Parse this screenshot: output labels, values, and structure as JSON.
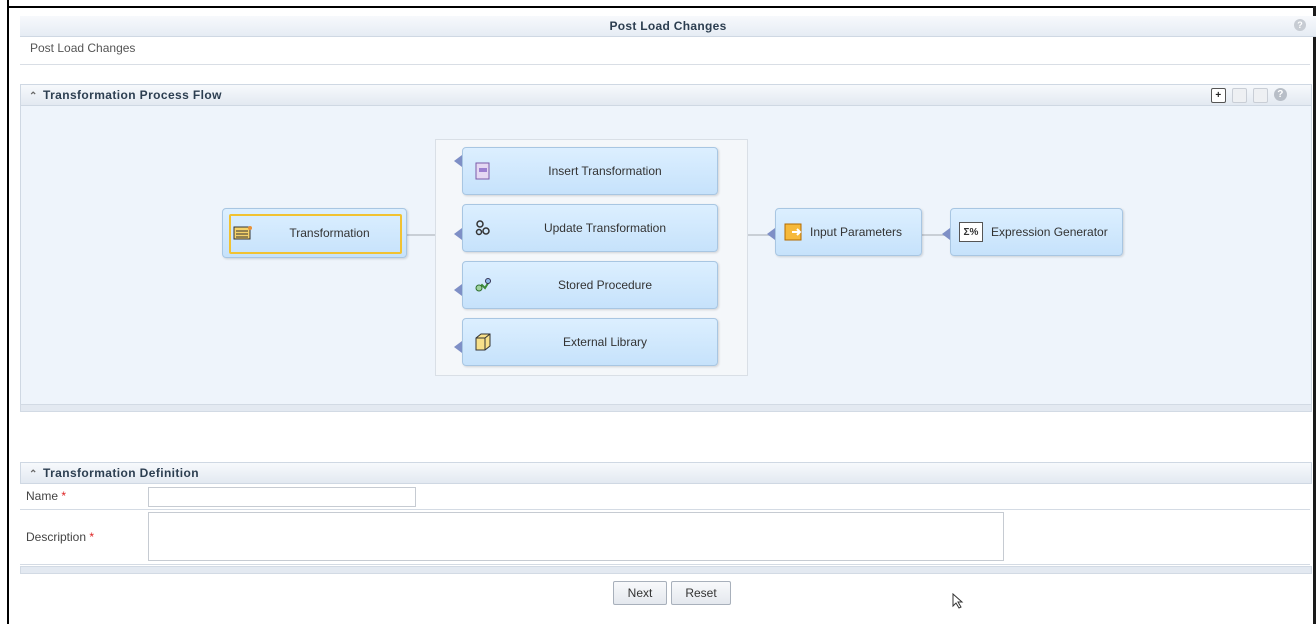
{
  "header": {
    "title": "Post Load Changes",
    "subtitle": "Post Load Changes"
  },
  "flow_section": {
    "title": "Transformation Process Flow",
    "toolbar": [
      "add-icon",
      "edit-icon",
      "list-icon",
      "help-icon"
    ],
    "nodes": {
      "transformation": "Transformation",
      "insert": "Insert Transformation",
      "update": "Update Transformation",
      "stored": "Stored Procedure",
      "external": "External Library",
      "input_params": "Input Parameters",
      "expression": "Expression Generator",
      "expression_icon_text": "Σ%"
    }
  },
  "definition_section": {
    "title": "Transformation Definition",
    "name_label": "Name",
    "name_value": "",
    "description_label": "Description",
    "description_value": "",
    "required_mark": "*"
  },
  "buttons": {
    "next": "Next",
    "reset": "Reset"
  }
}
